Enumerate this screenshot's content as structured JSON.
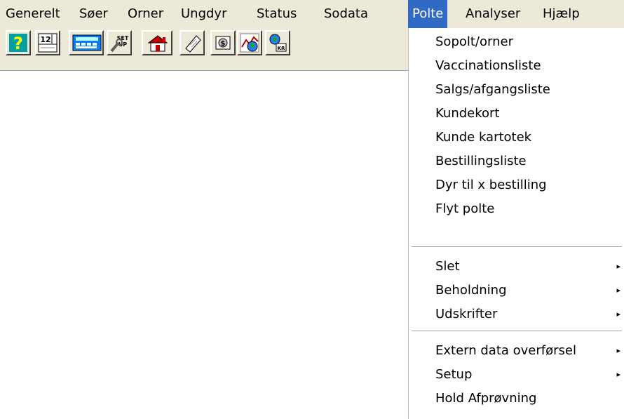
{
  "menubar": {
    "items": [
      {
        "label": "Generelt"
      },
      {
        "label": "Søer"
      },
      {
        "label": "Orner"
      },
      {
        "label": "Ungdyr"
      },
      {
        "label": "Status"
      },
      {
        "label": "Sodata"
      },
      {
        "label": "Polte",
        "active": true
      },
      {
        "label": "Analyser"
      },
      {
        "label": "Hjælp"
      }
    ]
  },
  "toolbar": {
    "buttons": [
      {
        "icon": "help-icon"
      },
      {
        "icon": "calendar-icon",
        "text": "12"
      },
      {
        "icon": "calculator-icon"
      },
      {
        "icon": "setup-icon",
        "text": "SET UP"
      },
      {
        "icon": "farm-house-icon"
      },
      {
        "icon": "notepad-icon"
      },
      {
        "icon": "money-icon"
      },
      {
        "icon": "chart-globe-icon"
      },
      {
        "icon": "transfer-icon",
        "text": "KR"
      }
    ]
  },
  "polte_menu": {
    "group1": [
      {
        "label": "Sopolt/orner"
      },
      {
        "label": "Vaccinationsliste"
      },
      {
        "label": "Salgs/afgangsliste"
      },
      {
        "label": "Kundekort"
      },
      {
        "label": "Kunde kartotek"
      },
      {
        "label": "Bestillingsliste"
      },
      {
        "label": "Dyr til x bestilling"
      },
      {
        "label": "Flyt polte"
      }
    ],
    "group2": [
      {
        "label": "Slet",
        "submenu": true
      },
      {
        "label": "Beholdning",
        "submenu": true
      },
      {
        "label": "Udskrifter",
        "submenu": true
      }
    ],
    "group3": [
      {
        "label": "Extern data overførsel",
        "submenu": true
      },
      {
        "label": "Setup",
        "submenu": true
      },
      {
        "label": "Hold Afprøvning"
      }
    ],
    "submenu_arrow": "▸"
  },
  "colors": {
    "chrome": "#ece9d8",
    "highlight": "#316ac5"
  }
}
